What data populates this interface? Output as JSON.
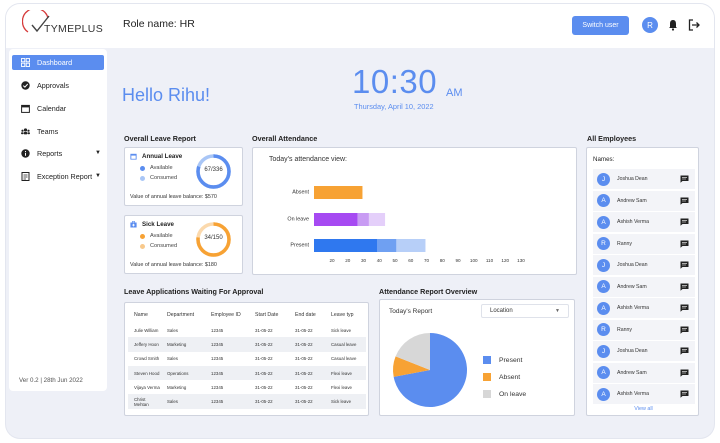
{
  "app": {
    "logo_text": "TYMEPLUS",
    "role_label": "Role name: HR",
    "switch_user": "Switch user",
    "avatar_initial": "R"
  },
  "colors": {
    "accent": "#5b8def",
    "orange": "#f7a234",
    "purple": "#a64af2",
    "light_purple": "#d9b8f6",
    "light_blue": "#a9c6f6",
    "grey": "#d7d7d7"
  },
  "sidebar": {
    "items": [
      {
        "label": "Dashboard",
        "icon": "dashboard-icon",
        "active": true
      },
      {
        "label": "Approvals",
        "icon": "check-circle-icon"
      },
      {
        "label": "Calendar",
        "icon": "calendar-icon"
      },
      {
        "label": "Teams",
        "icon": "team-icon"
      },
      {
        "label": "Reports",
        "icon": "info-icon",
        "caret": true
      },
      {
        "label": "Exception Report",
        "icon": "report-icon",
        "caret": true
      }
    ],
    "version": "Ver 0.2 | 28th Jun 2022"
  },
  "greeting": "Hello Rihu!",
  "clock": {
    "time": "10:30",
    "ampm": "AM",
    "date": "Thursday, April 10, 2022"
  },
  "overall_leave": {
    "title": "Overall Leave Report",
    "annual": {
      "title": "Annual Leave",
      "available": "Available",
      "consumed": "Consumed",
      "ratio": "67/336",
      "fraction": 0.8,
      "balance": "Value of annual leave balance: $570"
    },
    "sick": {
      "title": "Sick Leave",
      "available": "Available",
      "consumed": "Consumed",
      "ratio": "34/150",
      "fraction": 0.77,
      "balance": "Value of annual leave balance: $180"
    }
  },
  "attendance": {
    "title": "Overall  Attendance",
    "subtitle": "Today's attendance view:",
    "chart_data": {
      "type": "bar",
      "orientation": "horizontal",
      "categories": [
        "Absent",
        "On leave",
        "Present"
      ],
      "segments": [
        [
          {
            "value": 30,
            "color": "#f7a234"
          }
        ],
        [
          {
            "value": 27,
            "color": "#a64af2"
          },
          {
            "value": 7,
            "color": "#c89bf3"
          },
          {
            "value": 10,
            "color": "#e4cffa"
          }
        ],
        [
          {
            "value": 39,
            "color": "#2f78ef"
          },
          {
            "value": 12,
            "color": "#6fa0f2"
          },
          {
            "value": 18,
            "color": "#b7cff8"
          }
        ]
      ],
      "xticks": [
        "20",
        "20",
        "30",
        "40",
        "50",
        "60",
        "70",
        "80",
        "90",
        "100",
        "110",
        "120",
        "130"
      ],
      "xlim": [
        0,
        130
      ],
      "grid": false
    }
  },
  "approvals": {
    "title": "Leave Applications Waiting For Approval",
    "columns": [
      "Name",
      "Department",
      "Employee ID",
      "Start Date",
      "End date",
      "Leave typ"
    ],
    "rows": [
      [
        "Julie William",
        "Sales",
        "12345",
        "31-05-22",
        "31-05-22",
        "Sick leave"
      ],
      [
        "Jeffery Hoon",
        "Marketing",
        "12345",
        "31-05-22",
        "31-05-22",
        "Casual leave"
      ],
      [
        "Crowd Smith",
        "Sales",
        "12345",
        "31-05-22",
        "31-05-22",
        "Casual leave"
      ],
      [
        "Steven Hood",
        "Operations",
        "12345",
        "31-05-22",
        "31-05-22",
        "Flexi leave"
      ],
      [
        "Vijaya Verma",
        "Marketing",
        "12345",
        "31-05-22",
        "31-05-22",
        "Flexi leave"
      ],
      [
        "Christ Mehtan",
        "Sales",
        "12345",
        "31-05-22",
        "31-05-22",
        "Sick leave"
      ]
    ]
  },
  "attendance_overview": {
    "title": "Attendance Report Overview",
    "subtitle": "Today's Report",
    "dropdown": "Location",
    "chart_data": {
      "type": "pie",
      "labels": [
        "Present",
        "Absent",
        "On leave"
      ],
      "values": [
        72,
        9,
        19
      ],
      "colors": [
        "#5b8def",
        "#f7a234",
        "#d7d7d7"
      ]
    }
  },
  "employees": {
    "title": "All Employees",
    "header": "Names:",
    "list": [
      {
        "initial": "J",
        "name": "Joshua Dean"
      },
      {
        "initial": "A",
        "name": "Andrew Sam"
      },
      {
        "initial": "A",
        "name": "Ashish Verma"
      },
      {
        "initial": "R",
        "name": "Ranny"
      },
      {
        "initial": "J",
        "name": "Joshua Dean"
      },
      {
        "initial": "A",
        "name": "Andrew Sam"
      },
      {
        "initial": "A",
        "name": "Ashish Verma"
      },
      {
        "initial": "R",
        "name": "Ranny"
      },
      {
        "initial": "J",
        "name": "Joshua Dean"
      },
      {
        "initial": "A",
        "name": "Andrew Sam"
      },
      {
        "initial": "A",
        "name": "Ashish Verma"
      }
    ],
    "view_all": "View all"
  }
}
